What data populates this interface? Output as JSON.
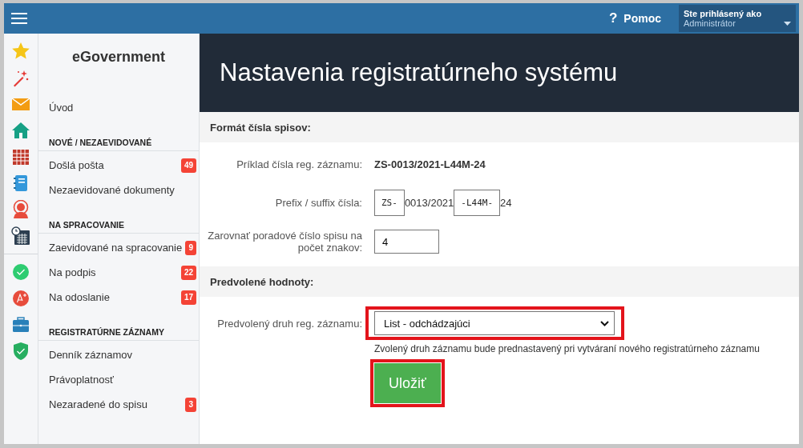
{
  "topbar": {
    "help_icon": "?",
    "help": "Pomoc",
    "user": {
      "caption": "Ste prihlásený ako",
      "name": "Administrátor"
    }
  },
  "sidebar": {
    "title": "eGovernment",
    "groups": [
      {
        "items": [
          {
            "label": "Úvod"
          }
        ]
      },
      {
        "heading": "NOVÉ / NEZAEVIDOVANÉ",
        "items": [
          {
            "label": "Došlá pošta",
            "badge": "49"
          },
          {
            "label": "Nezaevidované dokumenty"
          }
        ]
      },
      {
        "heading": "NA SPRACOVANIE",
        "items": [
          {
            "label": "Zaevidované na spracovanie",
            "badge": "9"
          },
          {
            "label": "Na podpis",
            "badge": "22"
          },
          {
            "label": "Na odoslanie",
            "badge": "17"
          }
        ]
      },
      {
        "heading": "REGISTRATÚRNE ZÁZNAMY",
        "items": [
          {
            "label": "Denník záznamov"
          },
          {
            "label": "Právoplatnosť"
          },
          {
            "label": "Nezaradené do spisu",
            "badge": "3"
          }
        ]
      }
    ]
  },
  "page": {
    "title": "Nastavenia registratúrneho systému",
    "sections": [
      {
        "heading": "Formát čísla spisov:",
        "rows": [
          {
            "kind": "text",
            "label": "Príklad čísla reg. záznamu:",
            "value": "ZS-0013/2021-L44M-24"
          },
          {
            "kind": "affix",
            "label": "Prefix / suffix čísla:",
            "prefix": "ZS-",
            "middle": "0013/2021",
            "suffix": "-L44M-",
            "end": "24"
          },
          {
            "kind": "input",
            "label": "Zarovnať poradové číslo spisu na počet znakov:",
            "value": "4"
          }
        ]
      },
      {
        "heading": "Predvolené hodnoty:",
        "rows": [
          {
            "kind": "select",
            "label": "Predvolený druh reg. záznamu:",
            "value": "List - odchádzajúci",
            "hint": "Zvolený druh záznamu bude prednastavený pri vytváraní nového registratúrneho záznamu",
            "highlighted": true
          }
        ]
      }
    ],
    "save": {
      "label": "Uložiť",
      "highlighted": true
    }
  }
}
